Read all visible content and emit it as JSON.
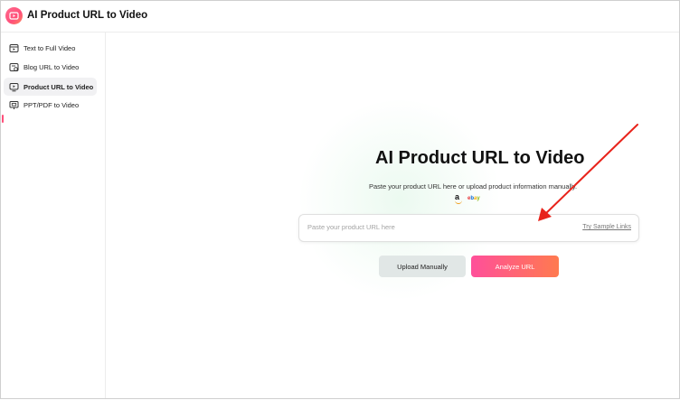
{
  "app": {
    "title": "AI Product URL to Video",
    "accent_color": "#ff4f7a",
    "logo_icon": "video-frame-icon"
  },
  "sidebar": {
    "items": [
      {
        "label": "Text to Full Video",
        "icon": "text-video-icon",
        "active": false
      },
      {
        "label": "Blog URL to Video",
        "icon": "blog-link-icon",
        "active": false
      },
      {
        "label": "Product URL to Video",
        "icon": "product-video-icon",
        "active": true
      },
      {
        "label": "PPT/PDF to Video",
        "icon": "presentation-icon",
        "active": false
      }
    ]
  },
  "main": {
    "title": "AI Product URL to Video",
    "subtitle": "Paste your product URL here or upload product information manually.",
    "brands": [
      "amazon-logo",
      "ebay-logo"
    ],
    "url_input": {
      "placeholder": "Paste your product URL here",
      "value": ""
    },
    "sample_link": "Try Sample Links",
    "upload_button": "Upload Manually",
    "analyze_button": "Analyze URL"
  },
  "annotation": {
    "arrow_color": "#e8231b"
  }
}
